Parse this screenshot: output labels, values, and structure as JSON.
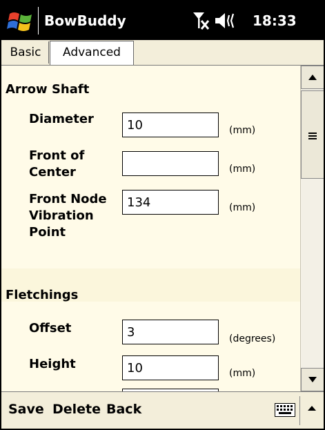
{
  "title_bar": {
    "app_title": "BowBuddy",
    "time": "18:33"
  },
  "tabs": [
    {
      "label": "Basic"
    },
    {
      "label": "Advanced"
    }
  ],
  "sections": {
    "arrow_shaft": {
      "title": "Arrow Shaft",
      "diameter": {
        "label": "Diameter",
        "value": "10",
        "unit": "(mm)"
      },
      "front_of_center": {
        "label_line1": "Front of",
        "label_line2": "Center",
        "value": "",
        "unit": "(mm)"
      },
      "front_node": {
        "label_line1": "Front Node",
        "label_line2": "Vibration",
        "label_line3": "Point",
        "value": "134",
        "unit": "(mm)"
      }
    },
    "fletchings": {
      "title": "Fletchings",
      "offset": {
        "label": "Offset",
        "value": "3",
        "unit": "(degrees)"
      },
      "height": {
        "label": "Height",
        "value": "10",
        "unit": "(mm)"
      }
    }
  },
  "menu": {
    "save": "Save",
    "delete": "Delete",
    "back": "Back"
  },
  "icons": [
    "windows-logo-icon",
    "signal-off-icon",
    "speaker-icon",
    "keyboard-icon",
    "scroll-up-icon",
    "scroll-down-icon",
    "menu-up-arrow-icon",
    "scroll-grip-icon"
  ],
  "colors": {
    "title_bg": "#000000",
    "content_bg": "#fffbe8",
    "bar_bg": "#f3eeda"
  }
}
